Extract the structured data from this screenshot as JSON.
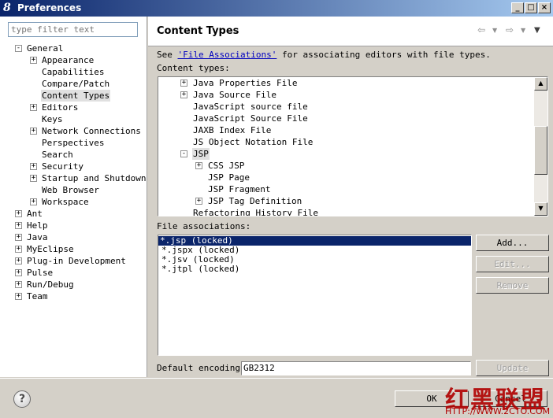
{
  "window": {
    "title": "Preferences",
    "app_icon": "8"
  },
  "left": {
    "filter_placeholder": "type filter text",
    "tree": [
      {
        "label": "General",
        "level": 0,
        "exp": "-"
      },
      {
        "label": "Appearance",
        "level": 1,
        "exp": "+"
      },
      {
        "label": "Capabilities",
        "level": 1,
        "exp": ""
      },
      {
        "label": "Compare/Patch",
        "level": 1,
        "exp": ""
      },
      {
        "label": "Content Types",
        "level": 1,
        "exp": "",
        "selected": true
      },
      {
        "label": "Editors",
        "level": 1,
        "exp": "+"
      },
      {
        "label": "Keys",
        "level": 1,
        "exp": ""
      },
      {
        "label": "Network Connections",
        "level": 1,
        "exp": "+"
      },
      {
        "label": "Perspectives",
        "level": 1,
        "exp": ""
      },
      {
        "label": "Search",
        "level": 1,
        "exp": ""
      },
      {
        "label": "Security",
        "level": 1,
        "exp": "+"
      },
      {
        "label": "Startup and Shutdown",
        "level": 1,
        "exp": "+"
      },
      {
        "label": "Web Browser",
        "level": 1,
        "exp": ""
      },
      {
        "label": "Workspace",
        "level": 1,
        "exp": "+"
      },
      {
        "label": "Ant",
        "level": 0,
        "exp": "+"
      },
      {
        "label": "Help",
        "level": 0,
        "exp": "+"
      },
      {
        "label": "Java",
        "level": 0,
        "exp": "+"
      },
      {
        "label": "MyEclipse",
        "level": 0,
        "exp": "+"
      },
      {
        "label": "Plug-in Development",
        "level": 0,
        "exp": "+"
      },
      {
        "label": "Pulse",
        "level": 0,
        "exp": "+"
      },
      {
        "label": "Run/Debug",
        "level": 0,
        "exp": "+"
      },
      {
        "label": "Team",
        "level": 0,
        "exp": "+"
      }
    ]
  },
  "right": {
    "page_title": "Content Types",
    "see_prefix": "See",
    "see_link": "'File Associations'",
    "see_suffix": "for associating editors with file types.",
    "content_types_label": "Content types:",
    "content_types": [
      {
        "label": "Java Properties File",
        "level": 1,
        "exp": "+"
      },
      {
        "label": "Java Source File",
        "level": 1,
        "exp": "+"
      },
      {
        "label": "JavaScript source file",
        "level": 1,
        "exp": ""
      },
      {
        "label": "JavaScript Source File",
        "level": 1,
        "exp": ""
      },
      {
        "label": "JAXB Index File",
        "level": 1,
        "exp": ""
      },
      {
        "label": "JS Object Notation File",
        "level": 1,
        "exp": ""
      },
      {
        "label": "JSP",
        "level": 1,
        "exp": "-",
        "highlighted": true
      },
      {
        "label": "CSS JSP",
        "level": 2,
        "exp": "+"
      },
      {
        "label": "JSP Page",
        "level": 2,
        "exp": ""
      },
      {
        "label": "JSP Fragment",
        "level": 2,
        "exp": ""
      },
      {
        "label": "JSP Tag Definition",
        "level": 2,
        "exp": "+"
      },
      {
        "label": "Refactoring History File",
        "level": 1,
        "exp": ""
      }
    ],
    "file_assoc_label": "File associations:",
    "file_associations": [
      {
        "label": "*.jsp (locked)",
        "selected": true
      },
      {
        "label": "*.jspx (locked)",
        "selected": false
      },
      {
        "label": "*.jsv (locked)",
        "selected": false
      },
      {
        "label": "*.jtpl (locked)",
        "selected": false
      }
    ],
    "buttons": {
      "add": "Add...",
      "edit": "Edit...",
      "remove": "Remove",
      "update": "Update"
    },
    "encoding_label": "Default encoding:",
    "encoding_value": "GB2312"
  },
  "bottom": {
    "ok": "OK",
    "cancel": "Cancel",
    "help_icon": "?"
  },
  "watermark": {
    "text": "红黑联盟",
    "url": "HTTP://WWW.2CTO.COM"
  }
}
